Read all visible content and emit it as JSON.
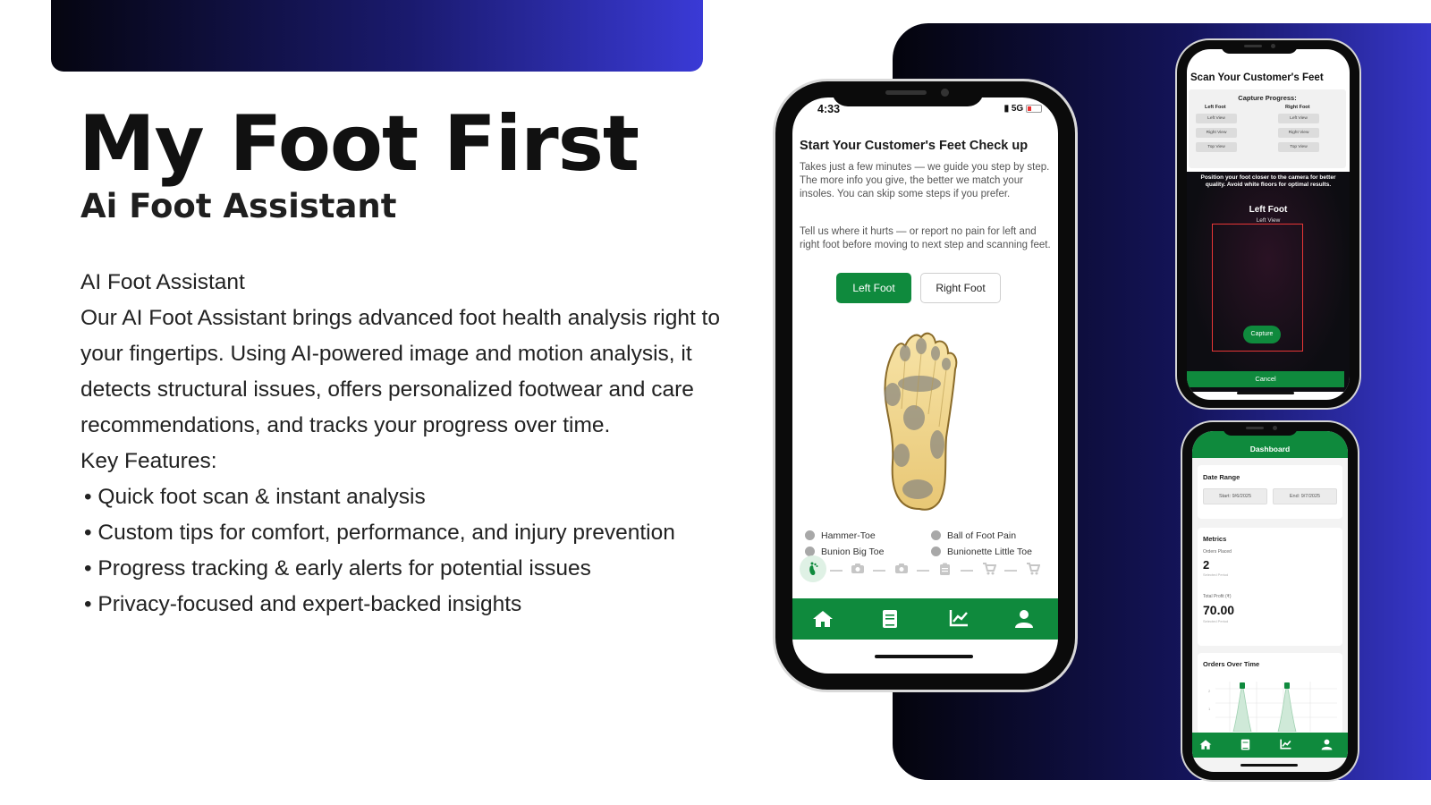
{
  "brand": {
    "title": "My Foot First",
    "subtitle": "Ai Foot Assistant",
    "colors": {
      "primary_green": "#0f8a3d",
      "gradient_dark": "#04040c",
      "gradient_blue": "#3636c8"
    }
  },
  "description": {
    "heading": "AI Foot Assistant",
    "body": "Our AI Foot Assistant brings advanced foot health analysis right to your fingertips. Using AI-powered image and motion analysis, it detects structural issues, offers personalized footwear and care recommendations, and tracks your progress over time.",
    "features_heading": "Key Features:",
    "features": [
      "• Quick foot scan & instant analysis",
      "• Custom tips for comfort, performance, and injury prevention",
      "• Progress tracking & early alerts for potential issues",
      "• Privacy-focused and expert-backed insights"
    ]
  },
  "main_phone": {
    "status": {
      "time": "4:33",
      "network": "5G"
    },
    "heading": "Start Your Customer's Feet Check up",
    "intro": "Takes just a few minutes — we guide you step by step. The more info you give, the better we match your insoles. You can skip some steps if you prefer.",
    "tell_us": "Tell us where it hurts — or report no pain for left and right foot before moving to next step and scanning feet.",
    "left_foot_button": "Left Foot",
    "right_foot_button": "Right Foot",
    "pain_points": [
      "Hammer-Toe",
      "Ball of Foot Pain",
      "Bunion Big Toe",
      "Bunionette Little Toe"
    ],
    "stepper_icons": [
      "foot-icon",
      "camera-icon",
      "camera-icon",
      "clipboard-icon",
      "cart-icon",
      "cart-icon"
    ],
    "nav": [
      "home-icon",
      "book-icon",
      "chart-icon",
      "user-icon"
    ]
  },
  "scan_phone": {
    "title": "Scan Your Customer's Feet",
    "progress_title": "Capture Progress:",
    "left_col": "Left Foot",
    "right_col": "Right Foot",
    "views": [
      "Left View",
      "Right View",
      "Top View"
    ],
    "tip": "Position your foot closer to the camera for better quality. Avoid white floors for optimal results.",
    "camera_label": "Left Foot",
    "camera_view": "Left View",
    "capture_button": "Capture",
    "cancel_button": "Cancel"
  },
  "dashboard_phone": {
    "title": "Dashboard",
    "date_range_title": "Date Range",
    "start": "Start: 9/6/2025",
    "end": "End: 9/7/2025",
    "metrics_title": "Metrics",
    "orders_label": "Orders Placed",
    "orders_value": "2",
    "orders_period": "Selected Period",
    "profit_label": "Total Profit (₹)",
    "profit_value": "70.00",
    "profit_period": "Selected Period",
    "chart_title": "Orders Over Time",
    "chart_data": {
      "type": "area",
      "peaks": 2
    },
    "nav": [
      "home-icon",
      "book-icon",
      "chart-icon",
      "user-icon"
    ]
  }
}
